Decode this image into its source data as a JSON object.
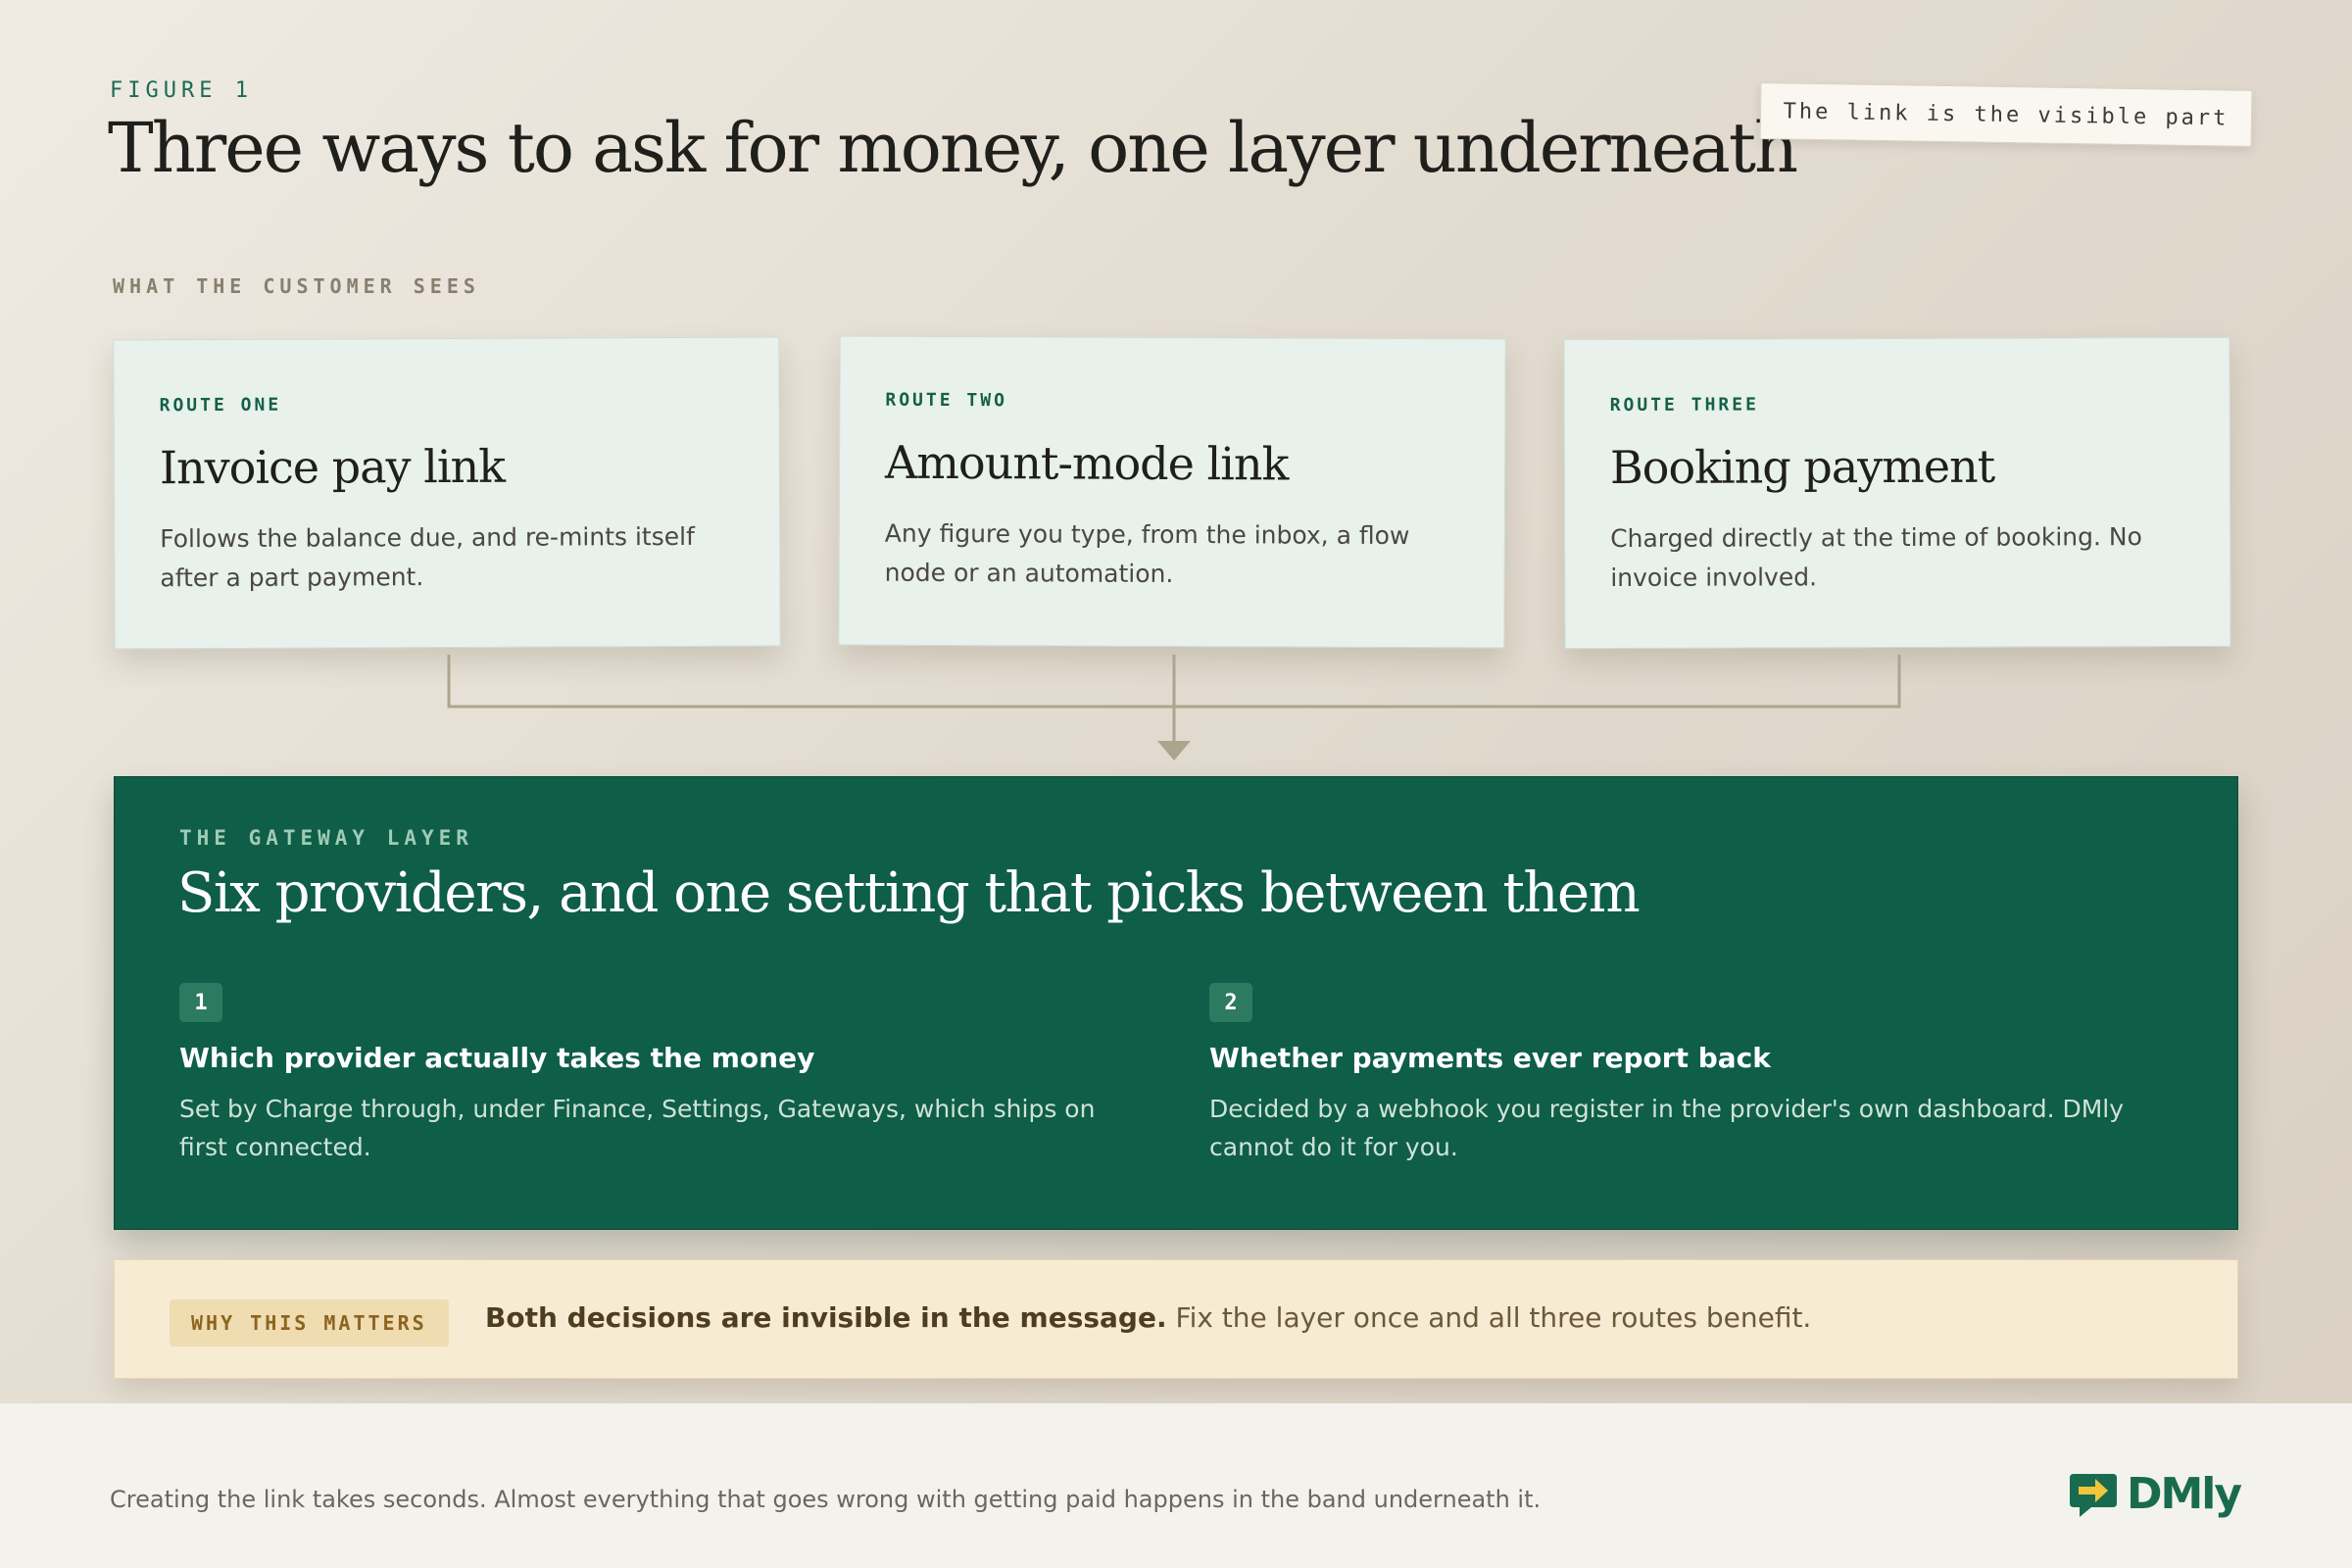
{
  "header": {
    "figure_label": "FIGURE 1",
    "title": "Three ways to ask for money, one layer underneath",
    "sticky_note": "The link is the visible part"
  },
  "customer_section": {
    "label": "WHAT THE CUSTOMER SEES",
    "routes": [
      {
        "kicker": "ROUTE ONE",
        "title": "Invoice pay link",
        "description": "Follows the balance due, and re-mints itself after a part payment."
      },
      {
        "kicker": "ROUTE TWO",
        "title": "Amount-mode link",
        "description": "Any figure you type, from the inbox, a flow node or an automation."
      },
      {
        "kicker": "ROUTE THREE",
        "title": "Booking payment",
        "description": "Charged directly at the time of booking. No invoice involved."
      }
    ]
  },
  "gateway": {
    "kicker": "THE GATEWAY LAYER",
    "title": "Six providers, and one setting that picks between them",
    "decisions": [
      {
        "number": "1",
        "title": "Which provider actually takes the money",
        "description": "Set by Charge through, under Finance, Settings, Gateways, which ships on first connected."
      },
      {
        "number": "2",
        "title": "Whether payments ever report back",
        "description": "Decided by a webhook you register in the provider's own dashboard. DMly cannot do it for you."
      }
    ]
  },
  "why": {
    "badge": "WHY THIS MATTERS",
    "strong": "Both decisions are invisible in the message.",
    "rest": " Fix the layer once and all three routes benefit."
  },
  "footer": {
    "caption": "Creating the link takes seconds. Almost everything that goes wrong with getting paid happens in the band underneath it.",
    "logo_text": "DMly",
    "logo_icon": "chat-arrow-icon"
  },
  "colors": {
    "accent_green": "#0f5e47",
    "route_card_bg": "#e9f1ec",
    "why_bg": "#f8ebd3",
    "connector": "#aca58e"
  }
}
